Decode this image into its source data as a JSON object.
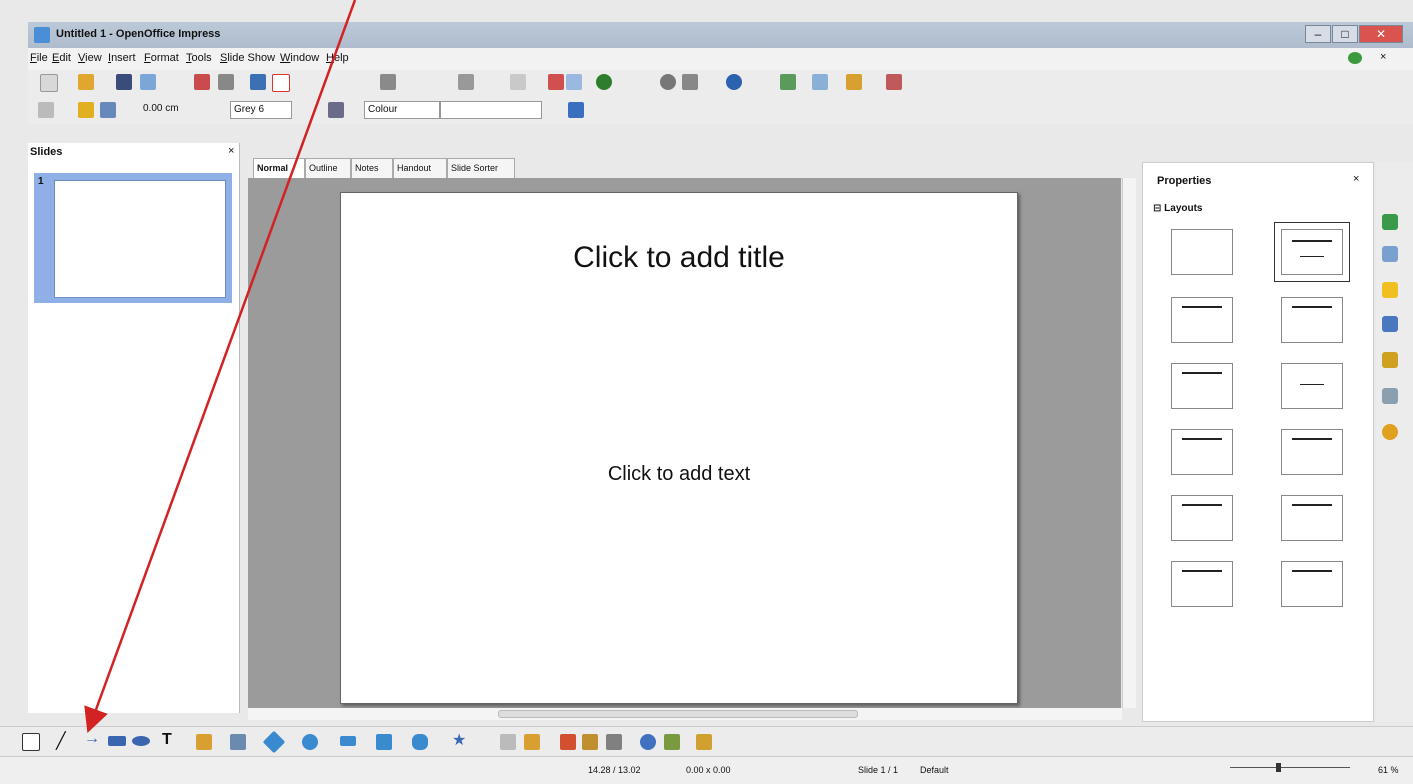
{
  "window": {
    "title": "Untitled 1 - OpenOffice Impress",
    "min_glyph": "–",
    "max_glyph": "□",
    "close_glyph": "✕"
  },
  "menu": [
    "File",
    "Edit",
    "View",
    "Insert",
    "Format",
    "Tools",
    "Slide Show",
    "Window",
    "Help"
  ],
  "formatting_toolbar": {
    "line_width": "0.00 cm",
    "line_color": "Grey 6",
    "area_style": "Colour"
  },
  "slides_pane": {
    "title": "Slides",
    "close": "×",
    "slide_number": "1"
  },
  "view_tabs": [
    "Normal",
    "Outline",
    "Notes",
    "Handout",
    "Slide Sorter"
  ],
  "slide": {
    "title_placeholder": "Click to add title",
    "text_placeholder": "Click to add text"
  },
  "properties": {
    "title": "Properties",
    "close": "×",
    "section": "⊟ Layouts"
  },
  "status_bar": {
    "position": "14.28 / 13.02",
    "size": "0.00 x 0.00",
    "slide": "Slide 1 / 1",
    "master": "Default",
    "zoom": "61 %"
  },
  "colors": {
    "annotation_arrow": "#d32222",
    "slide_selection": "#8fb0e6"
  }
}
